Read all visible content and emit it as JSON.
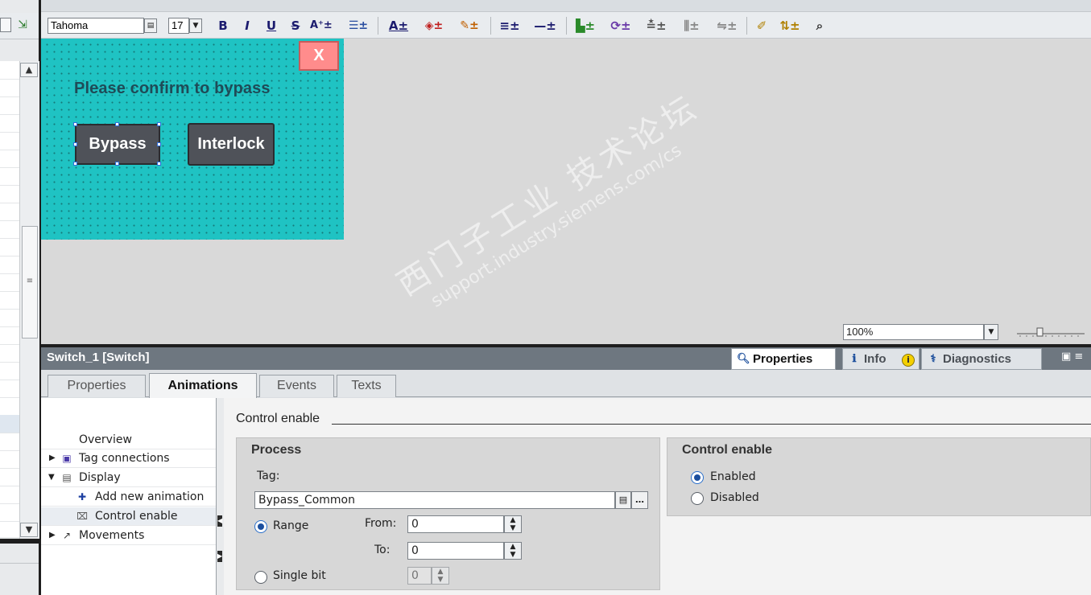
{
  "toolbar": {
    "font_name": "Tahoma",
    "font_size": "17",
    "bold": "B",
    "italic": "I",
    "underline": "U",
    "strike": "S",
    "icons": [
      "bold-icon",
      "italic-icon",
      "underline-icon",
      "strikethrough-icon",
      "font-size-increase-icon",
      "align-icon",
      "text-color-icon",
      "fill-color-icon",
      "line-color-icon",
      "line-style-icon",
      "line-width-icon",
      "layer-icon",
      "rotate-icon",
      "align-objects-icon",
      "distribute-icon",
      "same-size-icon",
      "format-painter-icon",
      "layer-order-icon",
      "zoom-selection-icon"
    ]
  },
  "screen": {
    "close_label": "X",
    "prompt": "Please confirm to bypass",
    "bypass_label": "Bypass",
    "interlock_label": "Interlock"
  },
  "zoom": {
    "value": "100%"
  },
  "inspector": {
    "title": "Switch_1 [Switch]",
    "tabs": [
      {
        "label": "Properties"
      },
      {
        "label": "Info"
      },
      {
        "label": "Diagnostics"
      }
    ],
    "sub_tabs": [
      {
        "label": "Properties"
      },
      {
        "label": "Animations"
      },
      {
        "label": "Events"
      },
      {
        "label": "Texts"
      }
    ]
  },
  "tree": {
    "items": [
      {
        "label": "Overview"
      },
      {
        "label": "Tag connections"
      },
      {
        "label": "Display"
      },
      {
        "label": "Add new animation"
      },
      {
        "label": "Control enable"
      },
      {
        "label": "Movements"
      }
    ]
  },
  "content": {
    "section_title": "Control enable",
    "process": {
      "title": "Process",
      "tag_label": "Tag:",
      "tag_value": "Bypass_Common",
      "range_label": "Range",
      "from_label": "From:",
      "from_value": "0",
      "to_label": "To:",
      "to_value": "0",
      "single_bit_label": "Single bit",
      "bit_value": "0"
    },
    "control_enable": {
      "title": "Control enable",
      "enabled_label": "Enabled",
      "disabled_label": "Disabled"
    }
  },
  "watermark": {
    "line1": "西门子工业 技术论坛",
    "line2": "support.industry.siemens.com/cs"
  },
  "colors": {
    "screen_bg": "#1fc3c3",
    "close_button": "#ff8c8c",
    "hmi_button": "#4f5259",
    "inspector_header": "#6e7780"
  }
}
